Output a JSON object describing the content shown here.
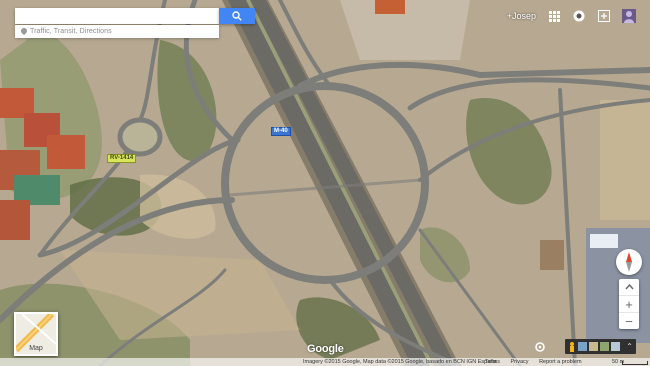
{
  "search": {
    "placeholder": "",
    "sub_text": "Traffic, Transit, Directions"
  },
  "user": {
    "name": "+Josep"
  },
  "roads": {
    "shield_main": "M-40",
    "shield_side": "RV-1414"
  },
  "layer_thumb": {
    "label": "Map"
  },
  "logo": "Google",
  "attribution": {
    "text": "Imagery ©2015 Google, Map data ©2015 Google, basado en BCN IGN España",
    "links": [
      "Terms",
      "Privacy",
      "Report a problem"
    ],
    "scale": "50 m"
  },
  "controls": {
    "zoom_in": "+",
    "zoom_out": "−"
  },
  "colors": {
    "accent": "#4285f4",
    "terrain": "#b7a991",
    "road": "#7d7d7a"
  },
  "icons": {
    "search": "search-icon",
    "apps": "apps-grid-icon",
    "notifications": "notification-bell-icon",
    "share": "share-icon",
    "compass": "compass-icon",
    "pegman": "pegman-icon"
  }
}
